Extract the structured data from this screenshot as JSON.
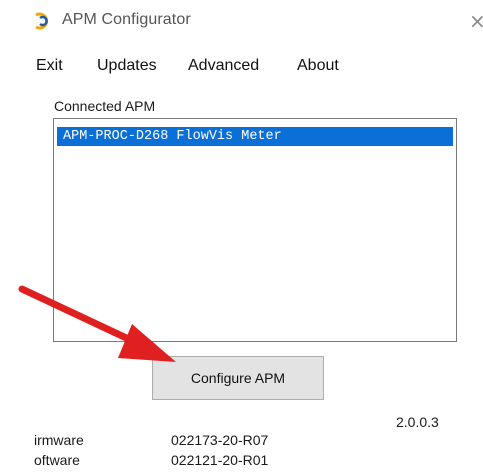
{
  "window": {
    "title": "APM Configurator",
    "close_glyph": "×",
    "icon": "apm-logo-icon"
  },
  "menu": {
    "items": [
      "Exit",
      "Updates",
      "Advanced",
      "About"
    ]
  },
  "connected": {
    "label": "Connected APM",
    "items": [
      "APM-PROC-D268 FlowVis Meter"
    ],
    "selected_index": 0
  },
  "actions": {
    "configure_label": "Configure APM"
  },
  "version": "2.0.0.3",
  "info": [
    {
      "label": "irmware",
      "value": "022173-20-R07"
    },
    {
      "label": "oftware",
      "value": "022121-20-R01"
    }
  ],
  "colors": {
    "selection": "#0a6fd6",
    "arrow": "#e02020",
    "button_bg": "#e3e3e3"
  },
  "annotation": {
    "icon": "red-arrow-icon"
  }
}
